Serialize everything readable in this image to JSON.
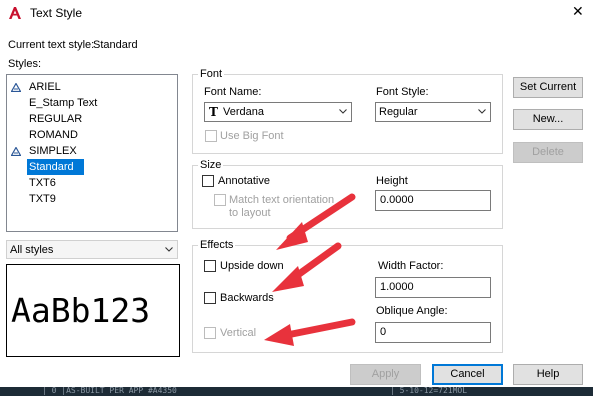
{
  "window": {
    "title": "Text Style",
    "close_glyph": "✕"
  },
  "current_style": {
    "label": "Current text style:",
    "value": "Standard"
  },
  "styles": {
    "label": "Styles:",
    "items": [
      {
        "label": "ARIEL",
        "icon": "annotative-icon",
        "selected": false
      },
      {
        "label": "E_Stamp Text",
        "icon": "",
        "selected": false
      },
      {
        "label": "REGULAR",
        "icon": "",
        "selected": false
      },
      {
        "label": "ROMAND",
        "icon": "",
        "selected": false
      },
      {
        "label": "SIMPLEX",
        "icon": "annotative-icon",
        "selected": false
      },
      {
        "label": "Standard",
        "icon": "",
        "selected": true
      },
      {
        "label": "TXT6",
        "icon": "",
        "selected": false
      },
      {
        "label": "TXT9",
        "icon": "",
        "selected": false
      }
    ]
  },
  "style_filter": {
    "value": "All styles"
  },
  "preview": {
    "text": "AaBb123"
  },
  "font": {
    "group_label": "Font",
    "font_name_label": "Font Name:",
    "font_name_value": "Verdana",
    "font_style_label": "Font Style:",
    "font_style_value": "Regular",
    "use_big_font_label": "Use Big Font"
  },
  "size": {
    "group_label": "Size",
    "annotative_label": "Annotative",
    "match_orientation_label_1": "Match text orientation",
    "match_orientation_label_2": "to layout",
    "height_label": "Height",
    "height_value": "0.0000"
  },
  "effects": {
    "group_label": "Effects",
    "upside_down_label": "Upside down",
    "backwards_label": "Backwards",
    "vertical_label": "Vertical",
    "width_factor_label": "Width Factor:",
    "width_factor_value": "1.0000",
    "oblique_angle_label": "Oblique Angle:",
    "oblique_angle_value": "0"
  },
  "buttons": {
    "set_current": "Set Current",
    "new": "New...",
    "delete": "Delete",
    "apply": "Apply",
    "cancel": "Cancel",
    "help": "Help"
  },
  "background_strip": {
    "text_left": "| 0 |AS-BUILT PER APP #A4350",
    "text_right": "| 5-10-12=721MOL"
  },
  "colors": {
    "arrow": "#e8323c",
    "accent": "#0078d7",
    "app_icon": "#c8102e"
  }
}
